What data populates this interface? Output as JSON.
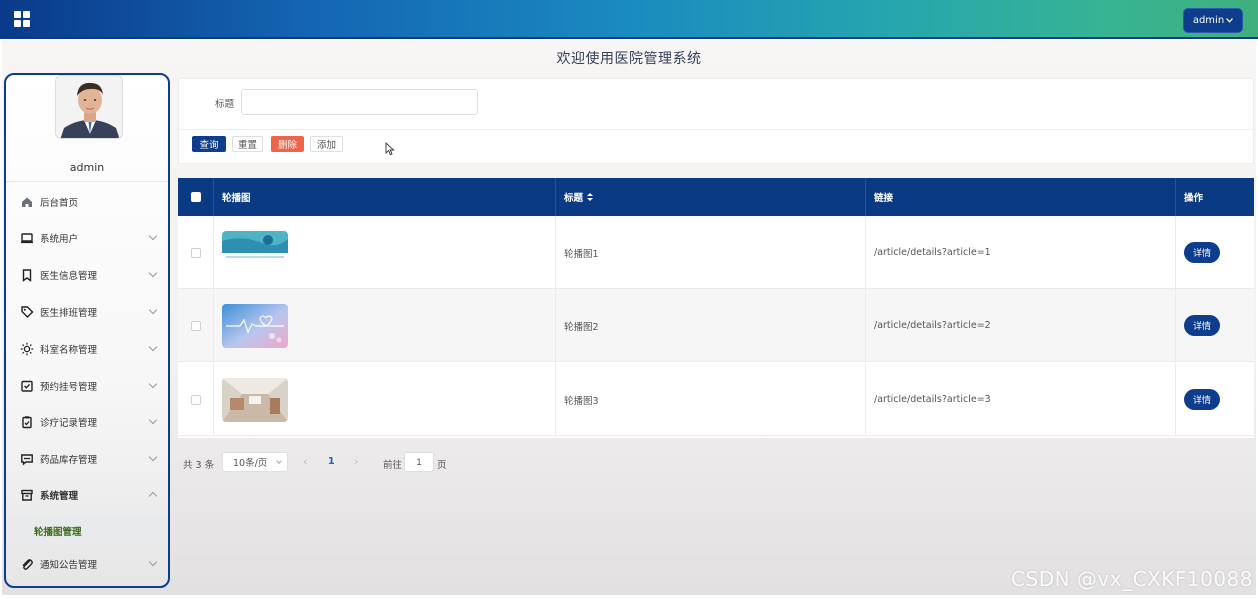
{
  "header": {
    "user_label": "admin",
    "welcome": "欢迎使用医院管理系统"
  },
  "sidebar": {
    "username": "admin",
    "items": [
      {
        "label": "后台首页",
        "icon": "home-icon"
      },
      {
        "label": "系统用户",
        "icon": "laptop-icon"
      },
      {
        "label": "医生信息管理",
        "icon": "bookmark-icon"
      },
      {
        "label": "医生排班管理",
        "icon": "tag-icon"
      },
      {
        "label": "科室名称管理",
        "icon": "sun-icon"
      },
      {
        "label": "预约挂号管理",
        "icon": "inbox-icon"
      },
      {
        "label": "诊疗记录管理",
        "icon": "clipboard-check-icon"
      },
      {
        "label": "药品库存管理",
        "icon": "message-icon"
      },
      {
        "label": "系统管理",
        "icon": "archive-icon"
      },
      {
        "label": "通知公告管理",
        "icon": "paperclip-icon"
      }
    ],
    "sub_item": "轮播图管理"
  },
  "search": {
    "label": "标题",
    "value": "",
    "placeholder": ""
  },
  "toolbar": {
    "query": "查询",
    "reset": "重置",
    "delete": "删除",
    "add": "添加"
  },
  "table": {
    "headers": [
      "轮播图",
      "标题",
      "链接",
      "操作"
    ],
    "rows": [
      {
        "title": "轮播图1",
        "link": "/article/details?article=1",
        "action": "详情"
      },
      {
        "title": "轮播图2",
        "link": "/article/details?article=2",
        "action": "详情"
      },
      {
        "title": "轮播图3",
        "link": "/article/details?article=3",
        "action": "详情"
      }
    ]
  },
  "pagination": {
    "total": "共 3 条",
    "page_size": "10条/页",
    "prev": "‹",
    "current": "1",
    "next": "›",
    "goto_label": "前往",
    "goto_value": "1",
    "page_suffix": "页"
  },
  "watermark": "CSDN @vx_CXKF10088",
  "colors": {
    "primary": "#0d3d8c",
    "danger": "#f0644a",
    "sub_active_text": "#3d6b1e"
  }
}
